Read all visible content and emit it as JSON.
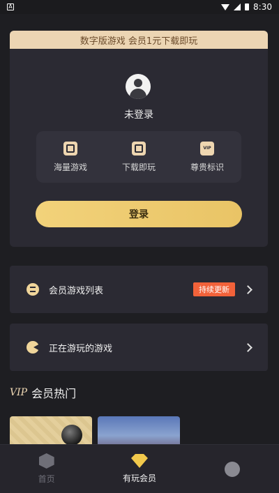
{
  "status_bar": {
    "left_glyph": "A",
    "time": "8:30"
  },
  "card": {
    "banner": "数字版游戏 会员1元下载即玩",
    "login_status": "未登录",
    "perks": [
      {
        "label": "海量游戏",
        "icon": "games-icon"
      },
      {
        "label": "下载即玩",
        "icon": "download-icon"
      },
      {
        "label": "尊贵标识",
        "icon": "vip-badge-icon"
      }
    ],
    "vip_text": "VIP",
    "login_button": "登录"
  },
  "rows": {
    "member_games": {
      "label": "会员游戏列表",
      "badge": "持续更新"
    },
    "playing_games": {
      "label": "正在游玩的游戏"
    }
  },
  "section": {
    "vip_mark": "VIP",
    "title": "会员热门"
  },
  "tabbar": {
    "home": "首页",
    "vip": "有玩会员"
  },
  "colors": {
    "accent_gold": "#f0d59a",
    "login_button": "#f2d27a",
    "badge": "#f2623a",
    "background": "#1e1e22"
  }
}
